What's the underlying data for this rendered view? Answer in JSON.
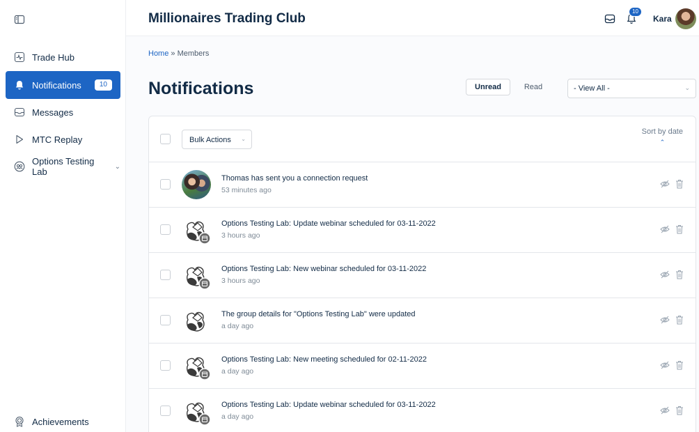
{
  "sidebar": {
    "items": [
      {
        "label": "Trade Hub",
        "icon": "pulse-icon"
      },
      {
        "label": "Notifications",
        "icon": "bell-icon",
        "badge": "10"
      },
      {
        "label": "Messages",
        "icon": "inbox-icon"
      },
      {
        "label": "MTC Replay",
        "icon": "play-icon"
      },
      {
        "label": "Options Testing Lab",
        "icon": "group-icon"
      }
    ],
    "footer": {
      "label": "Achievements",
      "icon": "award-icon"
    }
  },
  "header": {
    "title": "Millionaires Trading Club",
    "notification_count": "10",
    "user_name": "Kara"
  },
  "breadcrumb": {
    "home": "Home",
    "separator": " » ",
    "current": "Members"
  },
  "page": {
    "title": "Notifications",
    "unread_label": "Unread",
    "read_label": "Read",
    "view_select": "- View All -"
  },
  "list": {
    "bulk_label": "Bulk Actions",
    "sort_label": "Sort by date",
    "rows": [
      {
        "text": "Thomas has sent you a connection request",
        "time": "53 minutes ago",
        "avatar": "user-photo"
      },
      {
        "text": "Options Testing Lab: Update webinar scheduled for 03-11-2022",
        "time": "3 hours ago",
        "avatar": "group-calendar"
      },
      {
        "text": "Options Testing Lab: New webinar scheduled for 03-11-2022",
        "time": "3 hours ago",
        "avatar": "group-calendar"
      },
      {
        "text": "The group details for \"Options Testing Lab\" were updated",
        "time": "a day ago",
        "avatar": "group"
      },
      {
        "text": "Options Testing Lab: New meeting scheduled for 02-11-2022",
        "time": "a day ago",
        "avatar": "group-calendar"
      },
      {
        "text": "Options Testing Lab: Update webinar scheduled for 03-11-2022",
        "time": "a day ago",
        "avatar": "group-calendar"
      }
    ]
  },
  "colors": {
    "accent": "#1d65c4",
    "text": "#122b46",
    "muted": "#7f8b97"
  }
}
